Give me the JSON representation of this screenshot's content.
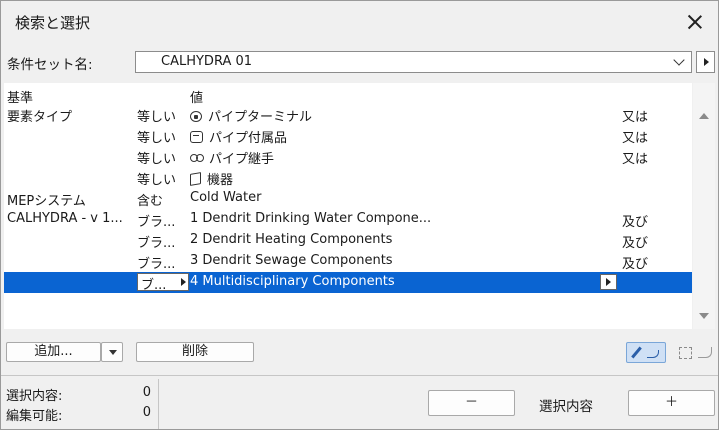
{
  "window": {
    "title": "検索と選択"
  },
  "condition_set": {
    "label": "条件セット名:",
    "value": "CALHYDRA 01"
  },
  "table": {
    "headers": {
      "criterion": "基準",
      "value": "値"
    },
    "rows": [
      {
        "criterion": "要素タイプ",
        "operator": "等しい",
        "icon": "pipe-terminal-icon",
        "value": "パイプターミナル",
        "logic": "又は"
      },
      {
        "criterion": "",
        "operator": "等しい",
        "icon": "pipe-accessory-icon",
        "value": "パイプ付属品",
        "logic": "又は"
      },
      {
        "criterion": "",
        "operator": "等しい",
        "icon": "pipe-fitting-icon",
        "value": "パイプ継手",
        "logic": "又は"
      },
      {
        "criterion": "",
        "operator": "等しい",
        "icon": "equipment-icon",
        "value": "機器",
        "logic": ""
      },
      {
        "criterion": "MEPシステム",
        "operator": "含む",
        "icon": "",
        "value": "Cold Water",
        "logic": ""
      },
      {
        "criterion": "CALHYDRA - v 1...",
        "operator": "ブラ...",
        "icon": "",
        "value": "1 Dendrit Drinking Water Compone...",
        "logic": "及び"
      },
      {
        "criterion": "",
        "operator": "ブラ...",
        "icon": "",
        "value": "2 Dendrit Heating Components",
        "logic": "及び"
      },
      {
        "criterion": "",
        "operator": "ブラ...",
        "icon": "",
        "value": "3 Dendrit Sewage Components",
        "logic": "及び"
      },
      {
        "criterion": "",
        "operator": "ブ...",
        "icon": "",
        "value": "4 Multidisciplinary Components",
        "logic": "",
        "selected": true
      }
    ]
  },
  "buttons": {
    "add": "追加...",
    "delete": "削除",
    "minus": "－",
    "plus": "＋"
  },
  "status": {
    "selection_label": "選択内容:",
    "selection_count": "0",
    "editable_label": "編集可能:",
    "editable_count": "0"
  },
  "selection_text": "選択内容",
  "colors": {
    "selection": "#0a64d2",
    "accent": "#cfe0f5"
  }
}
